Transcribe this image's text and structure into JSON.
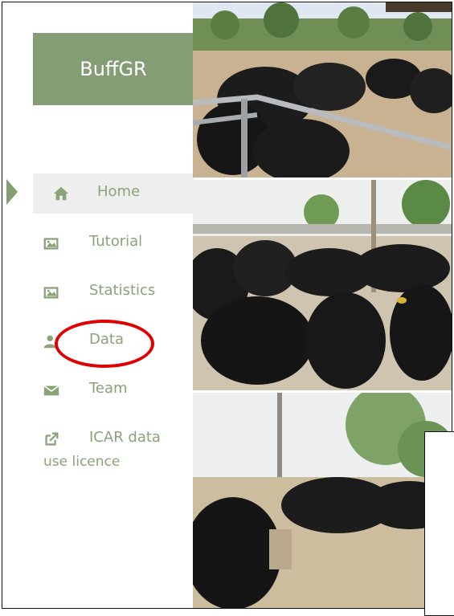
{
  "brand": {
    "title": "BuffGR",
    "color": "#849d74"
  },
  "nav": {
    "items": [
      {
        "label": "Home",
        "icon": "home-icon",
        "active": true
      },
      {
        "label": "Tutorial",
        "icon": "picture-icon"
      },
      {
        "label": "Statistics",
        "icon": "picture-icon"
      },
      {
        "label": "Data",
        "icon": "user-icon"
      },
      {
        "label": "Team",
        "icon": "envelope-icon"
      },
      {
        "label": "ICAR data",
        "label_line2": "use licence",
        "icon": "external-link-icon"
      }
    ],
    "text_color": "#8ba27b"
  },
  "annotation": {
    "color": "#e00000"
  }
}
